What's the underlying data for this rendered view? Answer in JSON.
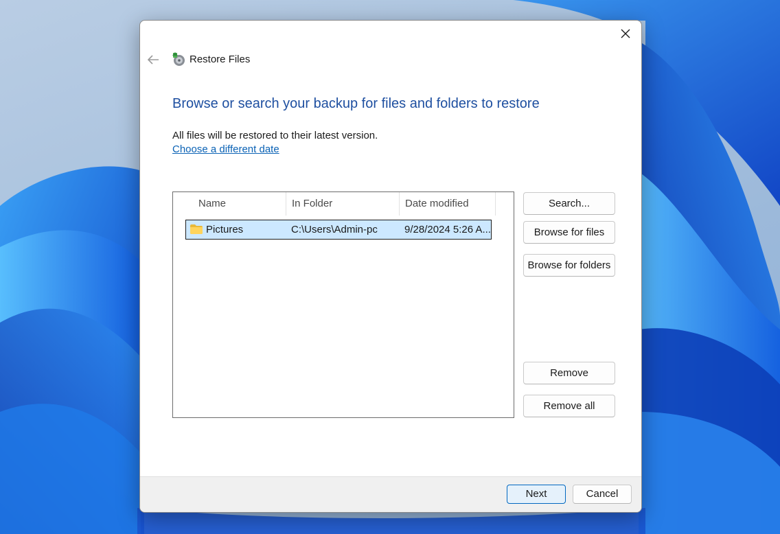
{
  "dialog": {
    "title": "Restore Files",
    "heading": "Browse or search your backup for files and folders to restore",
    "info": "All files will be restored to their latest version.",
    "link": "Choose a different date"
  },
  "list": {
    "columns": [
      "Name",
      "In Folder",
      "Date modified"
    ],
    "rows": [
      {
        "name": "Pictures",
        "folder": "C:\\Users\\Admin-pc",
        "date": "9/28/2024 5:26 A..."
      }
    ]
  },
  "buttons": {
    "search": "Search...",
    "browse_files": "Browse for files",
    "browse_folders": "Browse for folders",
    "remove": "Remove",
    "remove_all": "Remove all",
    "next": "Next",
    "cancel": "Cancel"
  },
  "icons": {
    "close": "close-icon",
    "back": "back-arrow-icon",
    "title": "restore-files-icon",
    "folder": "folder-icon"
  },
  "colors": {
    "heading": "#1e4fa0",
    "link": "#0a62b5",
    "selection": "#cce8ff",
    "primary_border": "#0067c0"
  }
}
